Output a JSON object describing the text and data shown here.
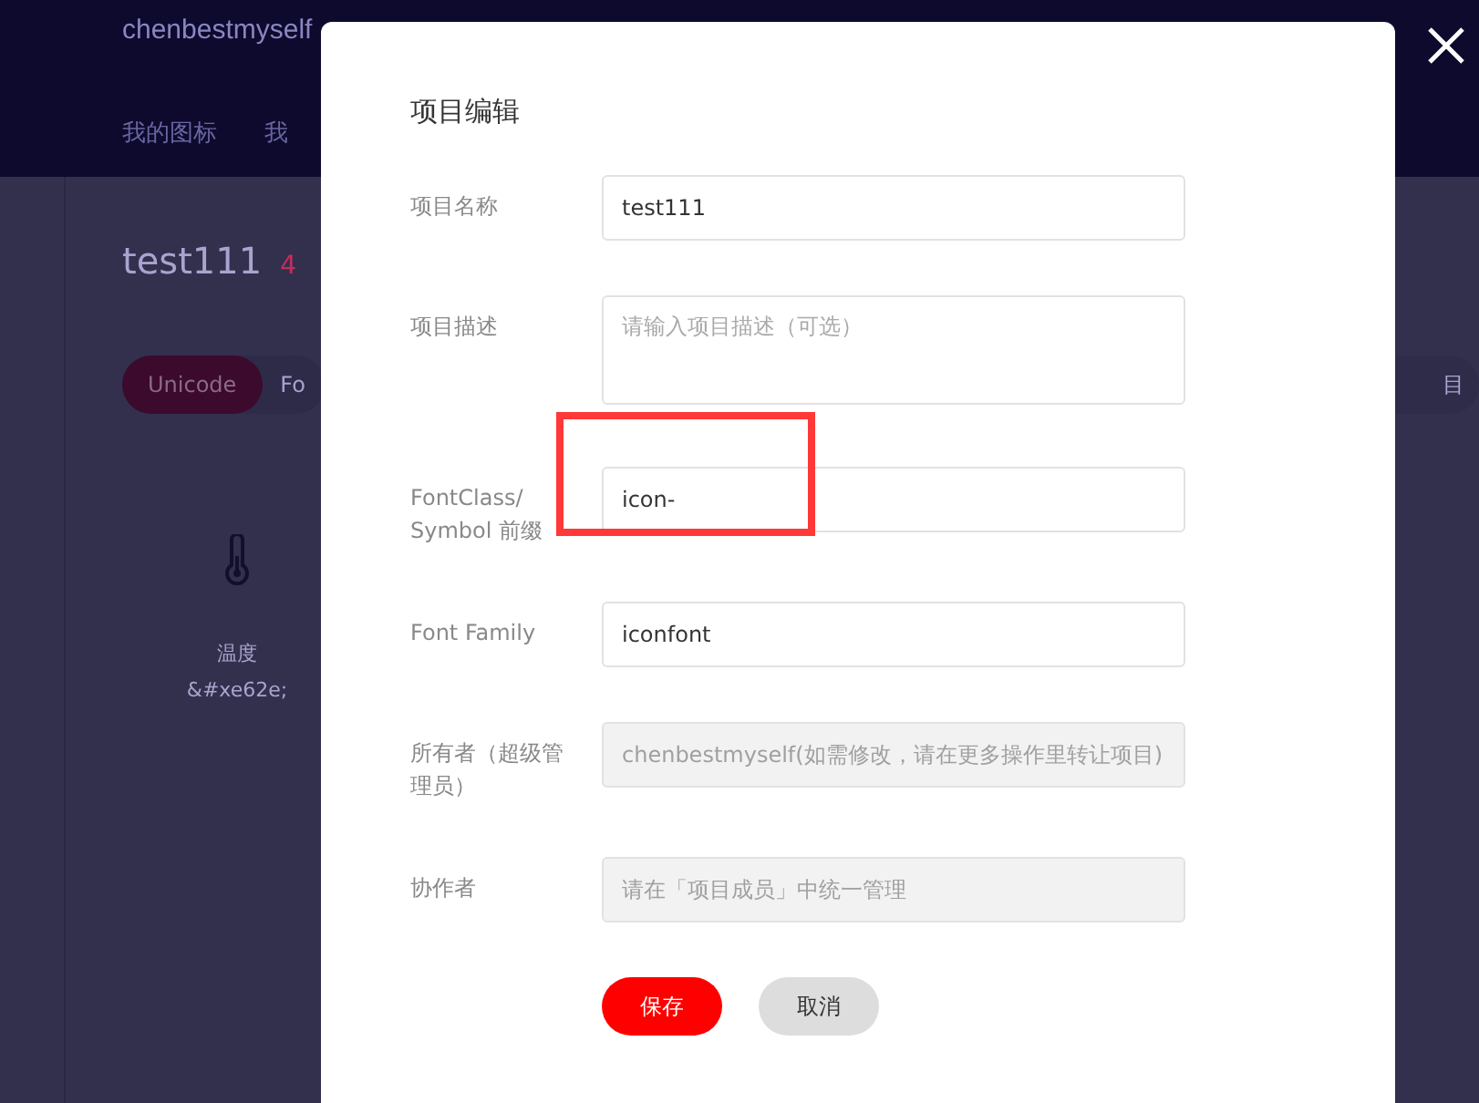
{
  "background": {
    "username": "chenbestmyself",
    "nav": [
      "我的图标",
      "我"
    ],
    "project_title": "test111",
    "icon_count": "4",
    "tabs": [
      {
        "label": "Unicode",
        "selected": true
      },
      {
        "label": "Fo",
        "selected": false
      }
    ],
    "right_pill": "目",
    "icon_card": {
      "name": "温度",
      "code": "&#xe62e;"
    }
  },
  "dialog": {
    "title": "项目编辑",
    "fields": [
      {
        "label": "项目名称",
        "kind": "input",
        "value": "test111",
        "disabled": false
      },
      {
        "label": "项目描述",
        "kind": "textarea",
        "placeholder": "请输入项目描述（可选）",
        "disabled": false
      },
      {
        "label": "FontClass/ Symbol 前缀",
        "kind": "input",
        "value": "icon-",
        "disabled": false,
        "highlighted": true
      },
      {
        "label": "Font Family",
        "kind": "input",
        "value": "iconfont",
        "disabled": false
      },
      {
        "label": "所有者（超级管理员）",
        "kind": "input",
        "placeholder": "chenbestmyself(如需修改，请在更多操作里转让项目)",
        "disabled": true
      },
      {
        "label": "协作者",
        "kind": "input",
        "placeholder": "请在「项目成员」中统一管理",
        "disabled": true
      }
    ],
    "buttons": [
      {
        "label": "保存",
        "kind": "primary"
      },
      {
        "label": "取消",
        "kind": "secondary"
      }
    ]
  }
}
